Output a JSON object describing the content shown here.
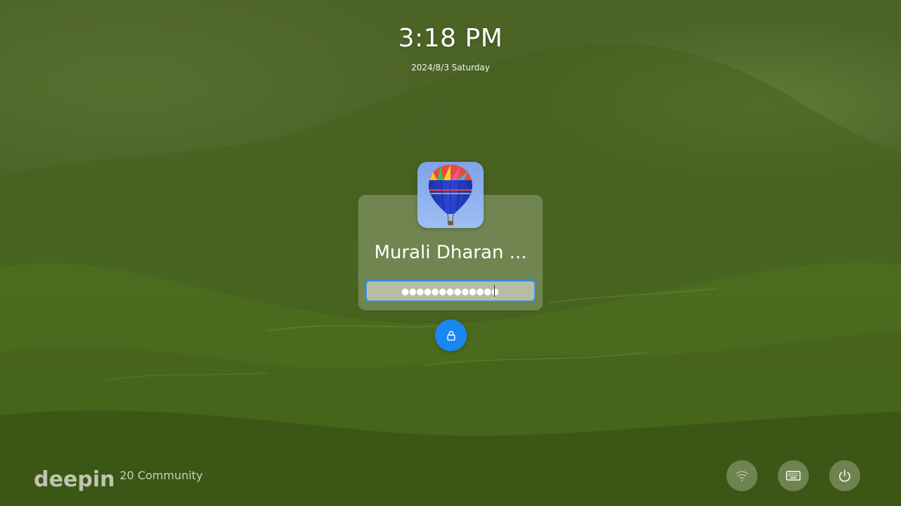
{
  "lockscreen": {
    "time": "3:18 PM",
    "date": "2024/8/3 Saturday",
    "user": {
      "name": "Murali Dharan ...",
      "avatar_icon": "hot-air-balloon-avatar"
    },
    "password": {
      "masked_value": "●●●●●●●●●●●●●",
      "focused": true
    },
    "unlock_icon": "lock-icon",
    "accent_color": "#1a86f2"
  },
  "branding": {
    "logo": "deepin",
    "edition": "20 Community"
  },
  "tray": {
    "network_icon": "wifi-icon",
    "keyboard_icon": "keyboard-icon",
    "power_icon": "power-icon"
  }
}
